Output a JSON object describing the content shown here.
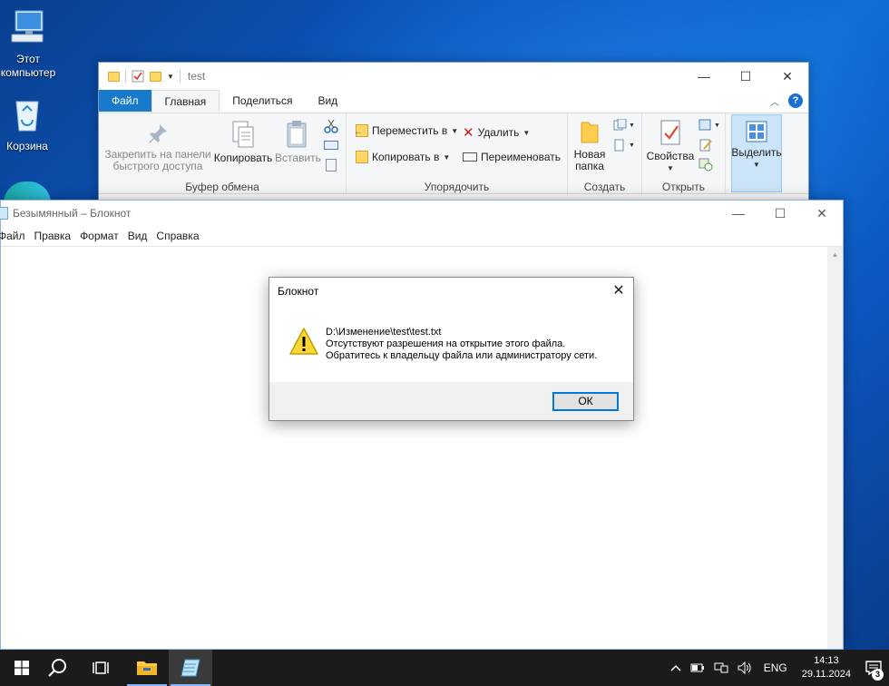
{
  "desktop": {
    "icons": [
      {
        "label_line1": "Этот",
        "label_line2": "компьютер"
      },
      {
        "label": "Корзина"
      }
    ]
  },
  "explorer": {
    "title": "test",
    "tabs": [
      "Файл",
      "Главная",
      "Поделиться",
      "Вид"
    ],
    "groups": {
      "clipboard": {
        "label": "Буфер обмена",
        "pin_line1": "Закрепить на панели",
        "pin_line2": "быстрого доступа",
        "copy": "Копировать",
        "paste": "Вставить"
      },
      "organize": {
        "label": "Упорядочить",
        "move_to": "Переместить в",
        "copy_to": "Копировать в",
        "delete": "Удалить",
        "rename": "Переименовать"
      },
      "new": {
        "label": "Создать",
        "new_folder_line1": "Новая",
        "new_folder_line2": "папка"
      },
      "open": {
        "label": "Открыть",
        "properties": "Свойства"
      },
      "select": {
        "label": "Выделить"
      }
    }
  },
  "notepad": {
    "title": "Безымянный – Блокнот",
    "menu": [
      "Файл",
      "Правка",
      "Формат",
      "Вид",
      "Справка"
    ]
  },
  "dialog": {
    "title": "Блокнот",
    "line1": "D:\\Изменение\\test\\test.txt",
    "line2": "Отсутствуют разрешения на открытие этого файла.",
    "line3": "Обратитесь к владельцу файла или администратору сети.",
    "ok_label": "ОК"
  },
  "taskbar": {
    "lang": "ENG",
    "time": "14:13",
    "date": "29.11.2024",
    "notification_count": "3"
  },
  "colors": {
    "file_tab": "#1979ca",
    "accent": "#0078d7",
    "taskbar": "#1b1b1b"
  }
}
